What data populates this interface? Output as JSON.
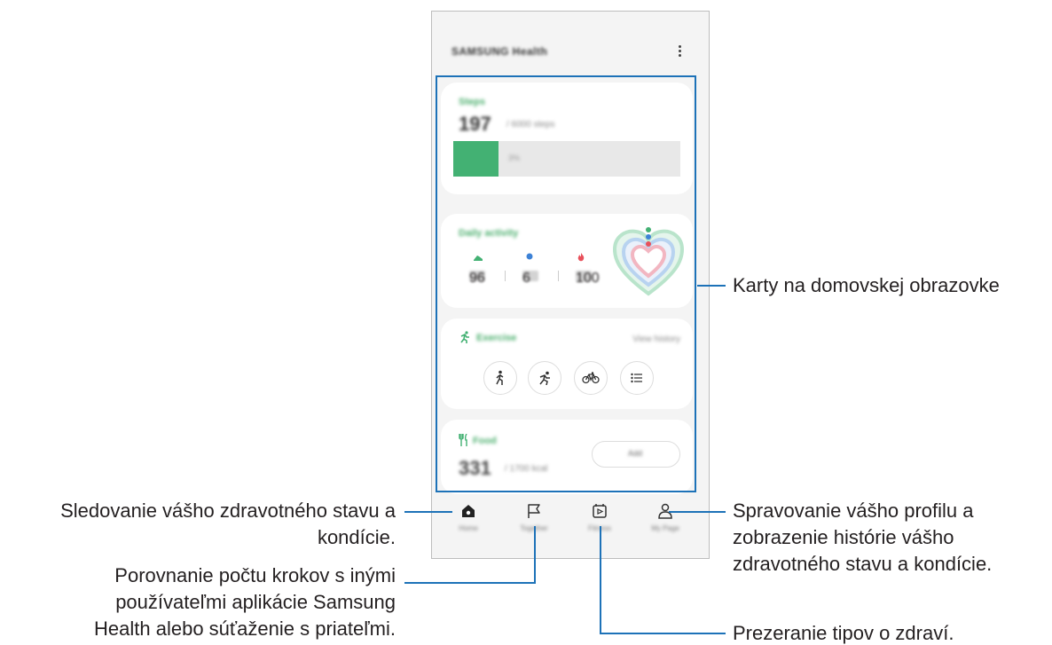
{
  "app": {
    "title": "SAMSUNG Health"
  },
  "cards": {
    "steps": {
      "label": "Steps",
      "value": "197",
      "goal": "/ 6000 steps",
      "progress_pct": "3%",
      "progress": 0.2
    },
    "daily_activity": {
      "label": "Daily activity",
      "values": [
        "96",
        "6",
        "100"
      ]
    },
    "exercise": {
      "label": "Exercise",
      "link": "View history"
    },
    "food": {
      "label": "Food",
      "value": "331",
      "unit": "/ 1700 kcal",
      "button": "Add"
    }
  },
  "nav": {
    "items": [
      {
        "label": "Home",
        "icon": "home-icon"
      },
      {
        "label": "Together",
        "icon": "flag-icon"
      },
      {
        "label": "Fitness",
        "icon": "fitness-icon"
      },
      {
        "label": "My Page",
        "icon": "person-icon"
      }
    ]
  },
  "callouts": {
    "cards": "Karty na domovskej obrazovke",
    "home": [
      "Sledovanie vášho zdravotného stavu a",
      "kondície."
    ],
    "together": [
      "Porovnanie počtu krokov s inými",
      "používateľmi aplikácie Samsung",
      "Health alebo súťaženie s priateľmi."
    ],
    "profile": [
      "Spravovanie vášho profilu a",
      "zobrazenie histórie vášho",
      "zdravotného stavu a kondície."
    ],
    "tips": "Prezeranie tipov o zdraví."
  },
  "colors": {
    "accent": "#1d72b8",
    "green": "#43b173"
  }
}
